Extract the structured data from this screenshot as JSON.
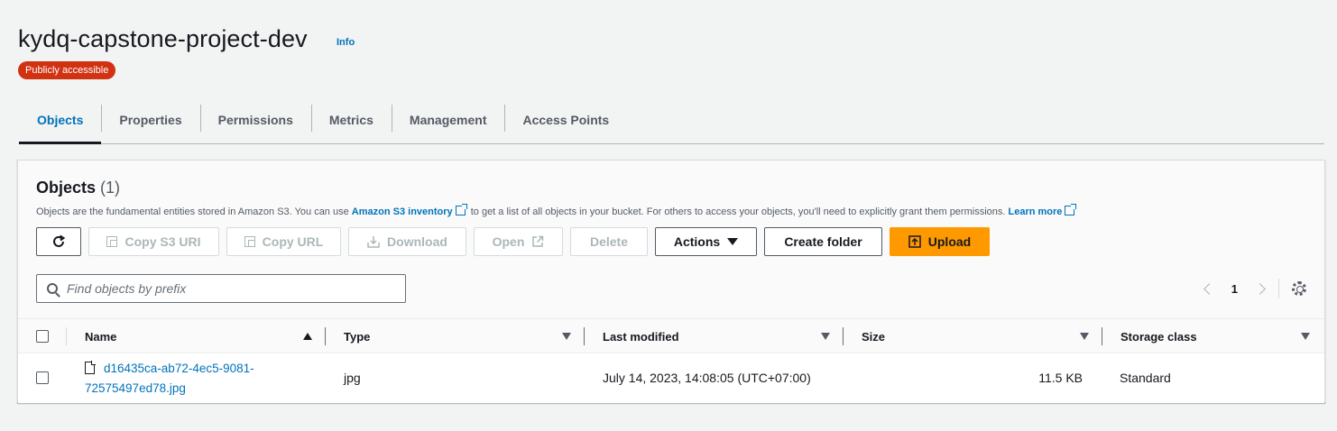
{
  "bucket": {
    "title": "kydq-capstone-project-dev",
    "info_label": "Info",
    "badge": "Publicly accessible"
  },
  "tabs": [
    {
      "label": "Objects",
      "active": true
    },
    {
      "label": "Properties",
      "active": false
    },
    {
      "label": "Permissions",
      "active": false
    },
    {
      "label": "Metrics",
      "active": false
    },
    {
      "label": "Management",
      "active": false
    },
    {
      "label": "Access Points",
      "active": false
    }
  ],
  "objects": {
    "title": "Objects",
    "count": "(1)",
    "desc_part1": "Objects are the fundamental entities stored in Amazon S3. You can use",
    "inventory_link": "Amazon S3 inventory",
    "desc_part2": "to get a list of all objects in your bucket. For others to access your objects, you'll need to explicitly grant them permissions.",
    "learn_more": "Learn more"
  },
  "toolbar": {
    "copy_s3_uri": "Copy S3 URI",
    "copy_url": "Copy URL",
    "download": "Download",
    "open": "Open",
    "delete": "Delete",
    "actions": "Actions",
    "create_folder": "Create folder",
    "upload": "Upload"
  },
  "search": {
    "placeholder": "Find objects by prefix",
    "value": ""
  },
  "pagination": {
    "current_page": "1"
  },
  "table": {
    "columns": [
      "Name",
      "Type",
      "Last modified",
      "Size",
      "Storage class"
    ],
    "rows": [
      {
        "name_line1": "d16435ca-ab72-4ec5-9081-",
        "name_line2": "72575497ed78.jpg",
        "type": "jpg",
        "last_modified": "July 14, 2023, 14:08:05 (UTC+07:00)",
        "size": "11.5 KB",
        "storage_class": "Standard"
      }
    ]
  },
  "colors": {
    "link": "#0073bb",
    "badge_bg": "#d13212",
    "primary_button": "#ff9900",
    "page_bg": "#f2f3f3"
  }
}
